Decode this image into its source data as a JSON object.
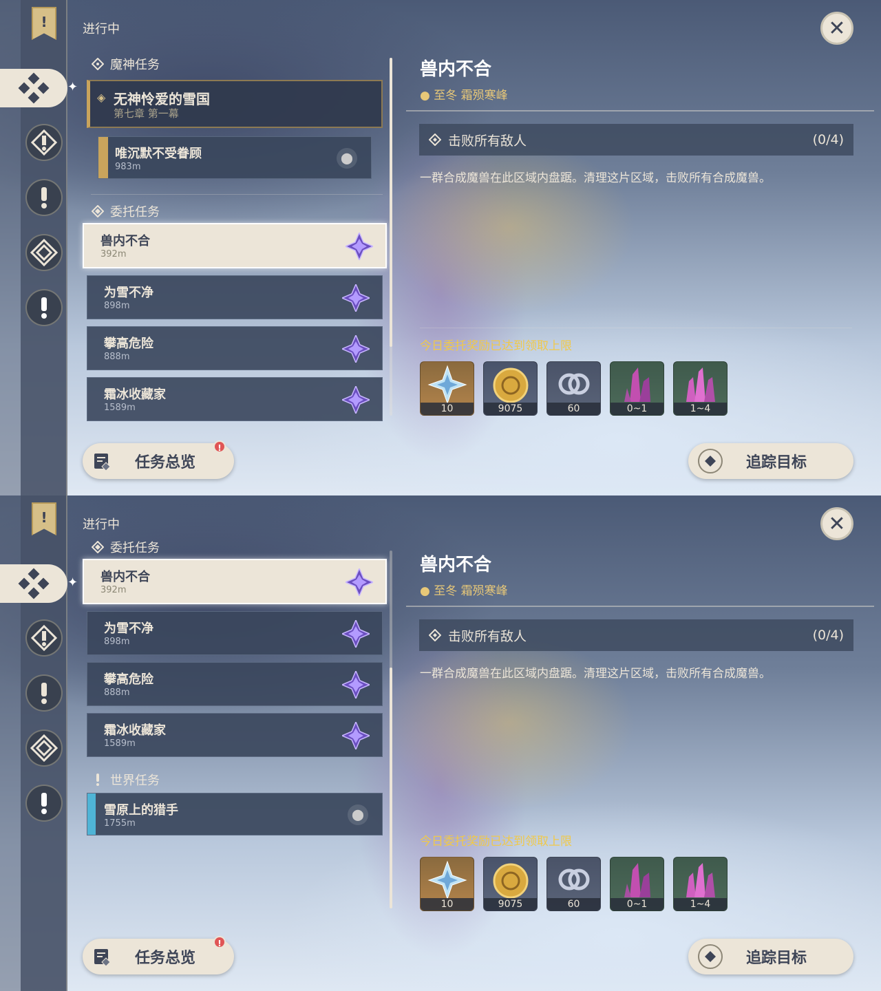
{
  "panels": [
    {
      "id": "p1",
      "header": "进行中",
      "archon_section": "魔神任务",
      "archon_quest": {
        "name": "无神怜爱的雪国",
        "chapter": "第七章 第一幕"
      },
      "archon_subquest": {
        "name": "唯沉默不受眷顾",
        "distance": "983m"
      },
      "commission_section": "委托任务",
      "commissions": [
        {
          "name": "兽内不合",
          "distance": "392m"
        },
        {
          "name": "为雪不净",
          "distance": "898m"
        },
        {
          "name": "攀高危险",
          "distance": "888m"
        },
        {
          "name": "霜冰收藏家",
          "distance": "1589m"
        }
      ]
    },
    {
      "id": "p2",
      "header": "进行中",
      "commission_section": "委托任务",
      "commissions": [
        {
          "name": "兽内不合",
          "distance": "392m"
        },
        {
          "name": "为雪不净",
          "distance": "898m"
        },
        {
          "name": "攀高危险",
          "distance": "888m"
        },
        {
          "name": "霜冰收藏家",
          "distance": "1589m"
        }
      ],
      "world_section": "世界任务",
      "world_quest": {
        "name": "雪原上的猎手",
        "distance": "1755m"
      }
    }
  ],
  "detail": {
    "title": "兽内不合",
    "location": "至冬 霜殒寒峰",
    "objective": "击败所有敌人",
    "progress": "(0/4)",
    "description": "一群合成魔兽在此区域内盘踞。清理这片区域，击败所有合成魔兽。",
    "reward_limit": "今日委托奖励已达到领取上限",
    "rewards": [
      {
        "icon": "primogem-icon",
        "count": "10"
      },
      {
        "icon": "mora-icon",
        "count": "9075"
      },
      {
        "icon": "friendship-exp-icon",
        "count": "60"
      },
      {
        "icon": "crystal-ore-icon",
        "count": "0~1"
      },
      {
        "icon": "crystal-chunk-icon",
        "count": "1~4"
      }
    ]
  },
  "buttons": {
    "overview": "任务总览",
    "track": "追踪目标",
    "overview_badge": "!"
  },
  "nav_icons": [
    "quest-banner-icon",
    "commission-icon",
    "archon-quest-icon",
    "world-quest-icon",
    "event-quest-icon",
    "exclamation-quest-icon"
  ],
  "colors": {
    "accent": "#ece5d8",
    "gold": "#c9a45c",
    "limit": "#f0c94a",
    "world_bar": "#4fb4d6"
  }
}
